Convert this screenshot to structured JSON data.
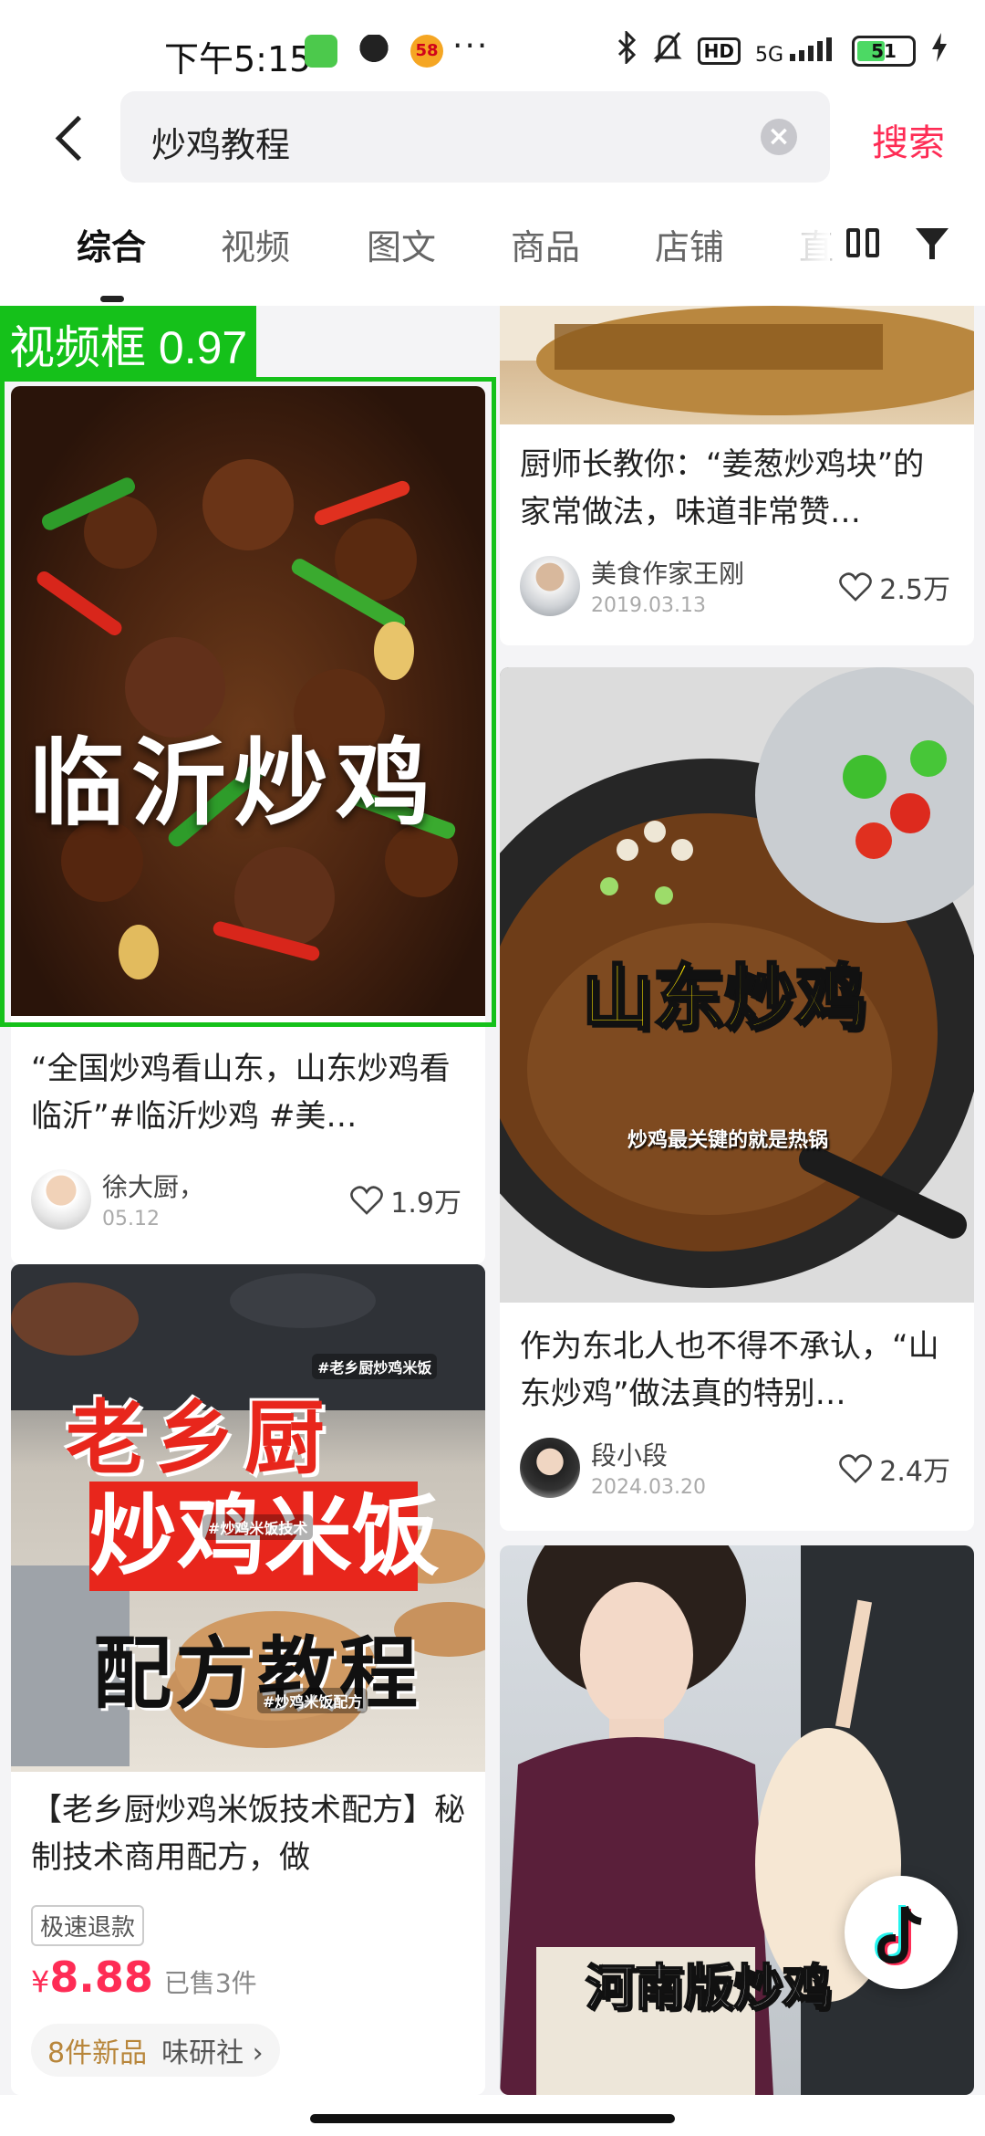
{
  "status_bar": {
    "time": "下午5:15",
    "more": "···",
    "hd": "HD",
    "network": "5G",
    "battery": "51",
    "app_58": "58"
  },
  "search": {
    "query": "炒鸡教程",
    "clear_glyph": "×",
    "submit_label": "搜索"
  },
  "tabs": [
    {
      "label": "综合",
      "active": true
    },
    {
      "label": "视频",
      "active": false
    },
    {
      "label": "图文",
      "active": false
    },
    {
      "label": "商品",
      "active": false
    },
    {
      "label": "店铺",
      "active": false
    },
    {
      "label": "直",
      "active": false
    }
  ],
  "detection": {
    "label": "视频框 0.97",
    "color": "#15c11a"
  },
  "left_column": [
    {
      "overlay": "临沂炒鸡",
      "title": "“全国炒鸡看山东，山东炒鸡看临沂”#临沂炒鸡 #美…",
      "author": "徐大厨，",
      "date": "05.12",
      "likes": "1.9万"
    },
    {
      "overlay_top": "老乡厨",
      "overlay_mid": "炒鸡米饭",
      "overlay_bottom": "配方教程",
      "tags": [
        "#老乡厨炒鸡米饭",
        "#炒鸡米饭技术",
        "#炒鸡米饭配方"
      ],
      "title": "【老乡厨炒鸡米饭技术配方】秘制技术商用配方，做",
      "badge": "极速退款",
      "price_currency": "¥",
      "price_value": "8.88",
      "sold": "已售3件",
      "shop_new": "8件新品",
      "shop_name": "味研社 ›"
    }
  ],
  "right_column": [
    {
      "title": "厨师长教你：“姜葱炒鸡块”的家常做法，味道非常赞…",
      "author": "美食作家王刚",
      "date": "2019.03.13",
      "likes": "2.5万"
    },
    {
      "overlay": "山东炒鸡",
      "caption": "炒鸡最关键的就是热锅",
      "title": "作为东北人也不得不承认，“山东炒鸡”做法真的特别…",
      "author": "段小段",
      "date": "2024.03.20",
      "likes": "2.4万"
    },
    {
      "overlay": "河南版炒鸡"
    }
  ],
  "icons": [
    "back-arrow-icon",
    "clear-icon",
    "layout-icon",
    "filter-icon",
    "heart-icon",
    "tiktok-icon"
  ],
  "accent_color": "#fe2c55"
}
